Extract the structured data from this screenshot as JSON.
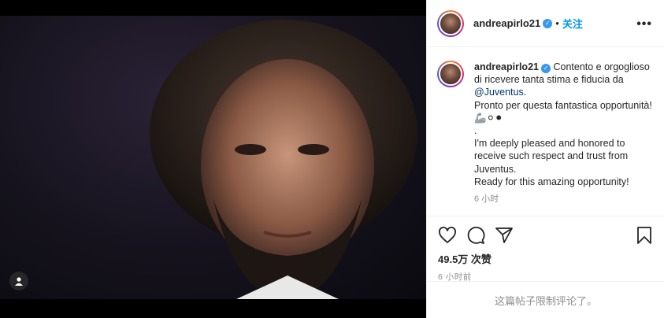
{
  "post": {
    "username": "andreapirlo21",
    "separator": "•",
    "follow_label": "关注",
    "more_label": "•••"
  },
  "caption": {
    "username": "andreapirlo21",
    "line1": "Contento e orgoglioso di ricevere tanta stima e fiducia da ",
    "mention": "@Juventus",
    "line1_end": ".",
    "line2": "Pronto per questa fantastica opportunità! 🦾⚪⚫",
    "line3": ".",
    "line4": "I'm deeply pleased and honored to receive such respect and trust from Juventus.",
    "line5": "Ready for this amazing opportunity!",
    "time": "6 小时"
  },
  "actions": {
    "like_icon": "heart-icon",
    "comment_icon": "comment-icon",
    "share_icon": "paper-plane-icon",
    "save_icon": "bookmark-icon",
    "likes_text": "49.5万 次赞",
    "posted_text": "6 小时前"
  },
  "footer": {
    "comments_disabled": "这篇帖子限制评论了。"
  },
  "colors": {
    "follow": "#0095f6",
    "verified": "#3897f0",
    "muted": "#8e8e8e",
    "text": "#262626"
  }
}
